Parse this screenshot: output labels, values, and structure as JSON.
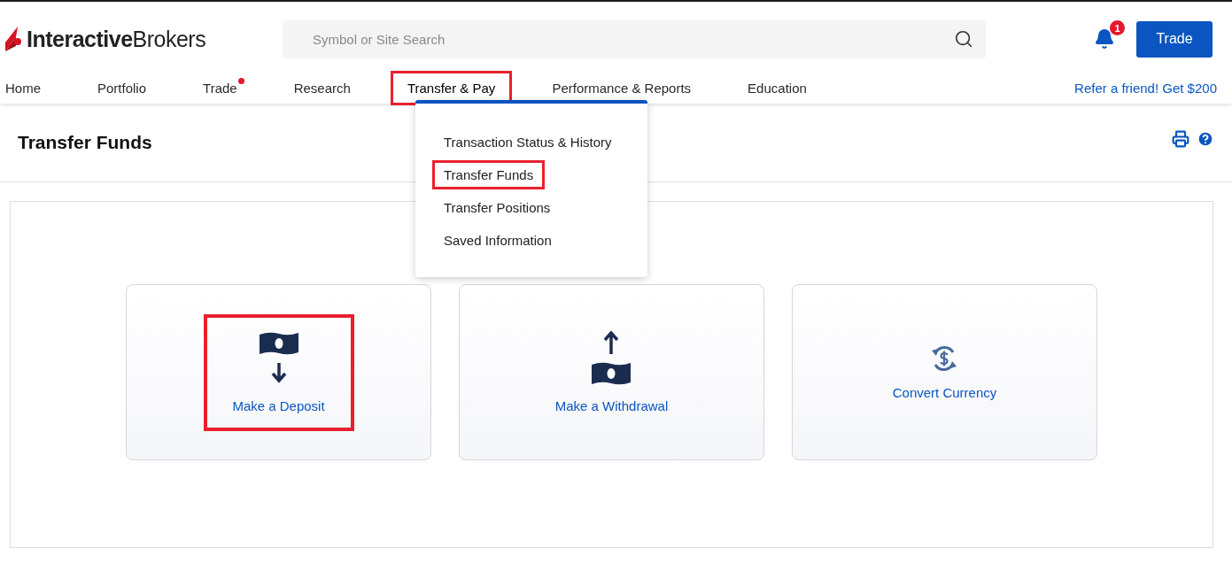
{
  "header": {
    "logo": {
      "bold": "Interactive",
      "light": "Brokers"
    },
    "search": {
      "placeholder": "Symbol or Site Search"
    },
    "notifications": {
      "count": "1"
    },
    "trade_button": "Trade"
  },
  "nav": {
    "items": [
      {
        "label": "Home",
        "selected": false,
        "dot": false,
        "highlighted": false
      },
      {
        "label": "Portfolio",
        "selected": false,
        "dot": false,
        "highlighted": false
      },
      {
        "label": "Trade",
        "selected": false,
        "dot": true,
        "highlighted": false
      },
      {
        "label": "Research",
        "selected": false,
        "dot": false,
        "highlighted": false
      },
      {
        "label": "Transfer & Pay",
        "selected": true,
        "dot": false,
        "highlighted": true
      },
      {
        "label": "Performance & Reports",
        "selected": false,
        "dot": false,
        "highlighted": false
      },
      {
        "label": "Education",
        "selected": false,
        "dot": false,
        "highlighted": false
      }
    ],
    "promo_link": "Refer a friend! Get $200"
  },
  "dropdown": {
    "items": [
      {
        "label": "Transaction Status & History",
        "highlighted": false
      },
      {
        "label": "Transfer Funds",
        "highlighted": true
      },
      {
        "label": "Transfer Positions",
        "highlighted": false
      },
      {
        "label": "Saved Information",
        "highlighted": false
      }
    ]
  },
  "page": {
    "title": "Transfer Funds"
  },
  "cards": [
    {
      "kind": "deposit",
      "label": "Make a Deposit",
      "highlighted": true
    },
    {
      "kind": "withdrawal",
      "label": "Make a Withdrawal",
      "highlighted": false
    },
    {
      "kind": "convert",
      "label": "Convert Currency",
      "highlighted": false
    }
  ]
}
